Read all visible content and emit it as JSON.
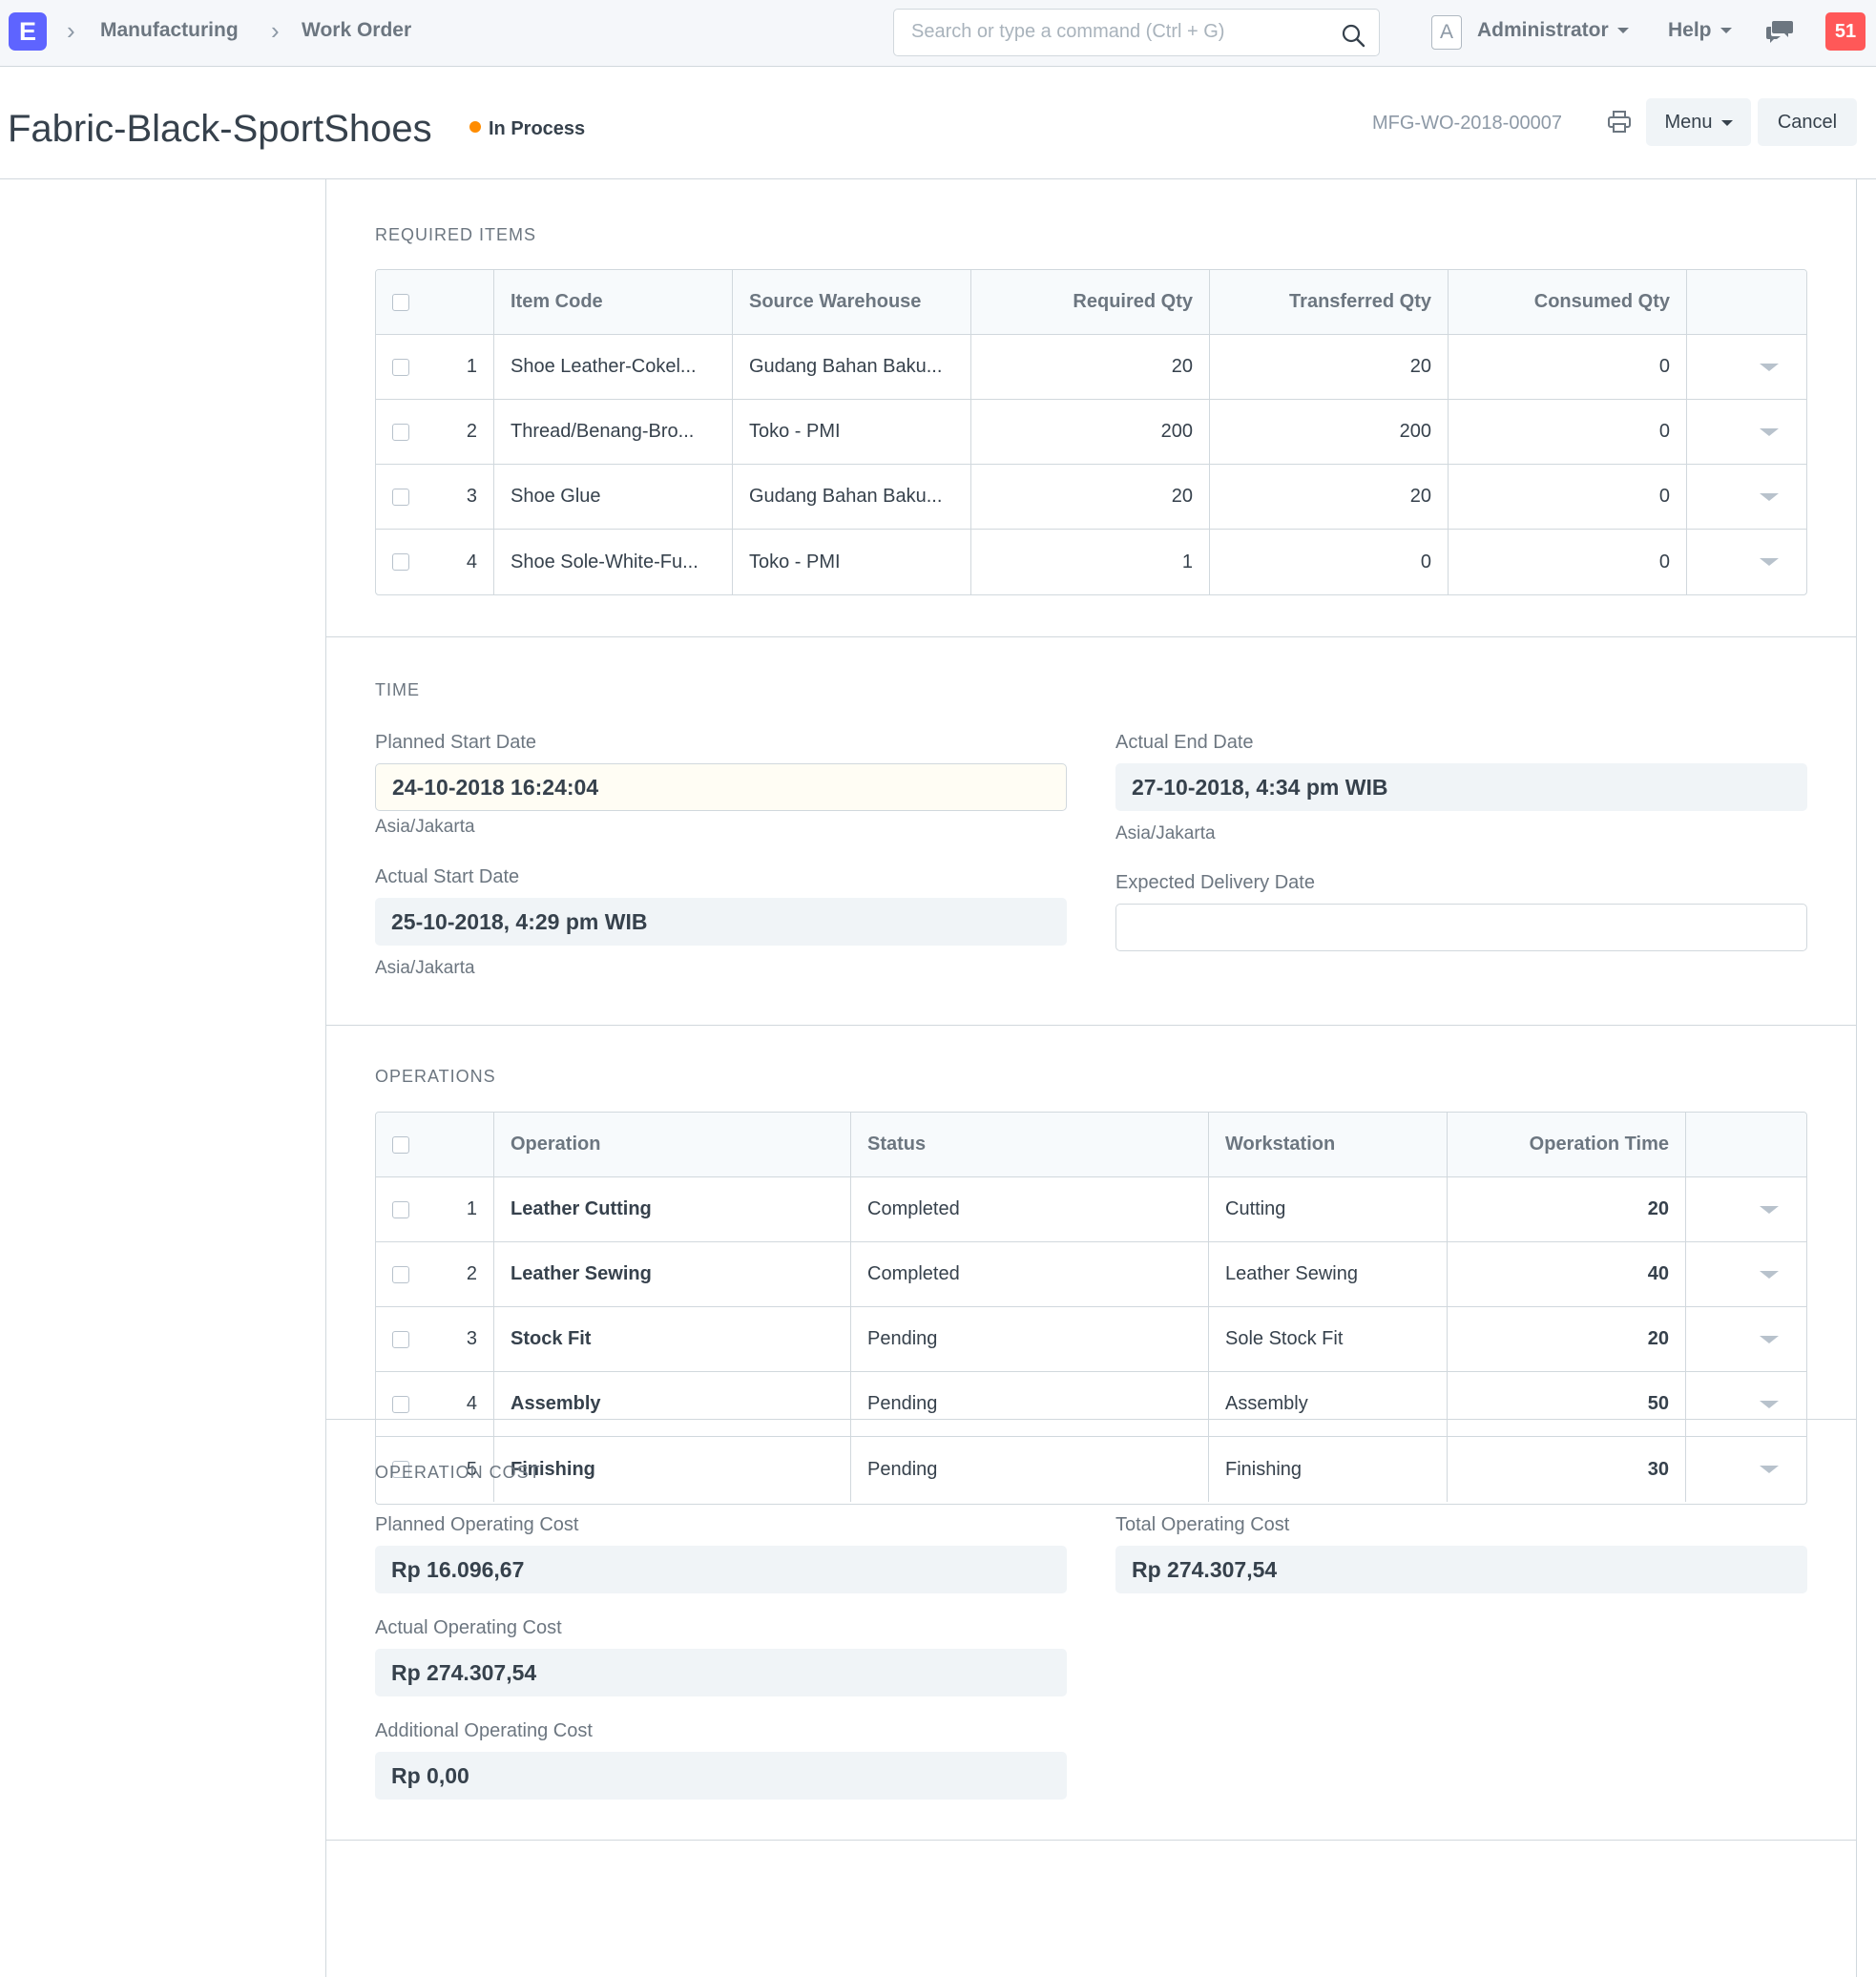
{
  "navbar": {
    "logo": "E",
    "breadcrumbs": [
      "Manufacturing",
      "Work Order"
    ],
    "search_placeholder": "Search or type a command (Ctrl + G)",
    "avatar_letter": "A",
    "user": "Administrator",
    "help": "Help",
    "notification_count": "51"
  },
  "page": {
    "title": "Fabric-Black-SportShoes",
    "status": "In Process",
    "status_color": "#ff8c00",
    "doc_name": "MFG-WO-2018-00007",
    "menu_label": "Menu",
    "cancel_label": "Cancel"
  },
  "required_items": {
    "heading": "REQUIRED ITEMS",
    "columns": [
      "Item Code",
      "Source Warehouse",
      "Required Qty",
      "Transferred Qty",
      "Consumed Qty"
    ],
    "rows": [
      {
        "idx": "1",
        "item_code": "Shoe Leather-Cokel...",
        "warehouse": "Gudang Bahan Baku...",
        "required": "20",
        "transferred": "20",
        "consumed": "0"
      },
      {
        "idx": "2",
        "item_code": "Thread/Benang-Bro...",
        "warehouse": "Toko - PMI",
        "required": "200",
        "transferred": "200",
        "consumed": "0"
      },
      {
        "idx": "3",
        "item_code": "Shoe Glue",
        "warehouse": "Gudang Bahan Baku...",
        "required": "20",
        "transferred": "20",
        "consumed": "0"
      },
      {
        "idx": "4",
        "item_code": "Shoe Sole-White-Fu...",
        "warehouse": "Toko - PMI",
        "required": "1",
        "transferred": "0",
        "consumed": "0"
      }
    ]
  },
  "time": {
    "heading": "TIME",
    "planned_start_label": "Planned Start Date",
    "planned_start_value": "24-10-2018 16:24:04",
    "planned_start_tz": "Asia/Jakarta",
    "actual_start_label": "Actual Start Date",
    "actual_start_value": "25-10-2018, 4:29 pm WIB",
    "actual_start_tz": "Asia/Jakarta",
    "actual_end_label": "Actual End Date",
    "actual_end_value": "27-10-2018, 4:34 pm WIB",
    "actual_end_tz": "Asia/Jakarta",
    "expected_delivery_label": "Expected Delivery Date",
    "expected_delivery_value": ""
  },
  "operations": {
    "heading": "OPERATIONS",
    "columns": [
      "Operation",
      "Status",
      "Workstation",
      "Operation Time"
    ],
    "rows": [
      {
        "idx": "1",
        "operation": "Leather Cutting",
        "status": "Completed",
        "workstation": "Cutting",
        "time": "20"
      },
      {
        "idx": "2",
        "operation": "Leather Sewing",
        "status": "Completed",
        "workstation": "Leather Sewing",
        "time": "40"
      },
      {
        "idx": "3",
        "operation": "Stock Fit",
        "status": "Pending",
        "workstation": "Sole Stock Fit",
        "time": "20"
      },
      {
        "idx": "4",
        "operation": "Assembly",
        "status": "Pending",
        "workstation": "Assembly",
        "time": "50"
      },
      {
        "idx": "5",
        "operation": "Finishing",
        "status": "Pending",
        "workstation": "Finishing",
        "time": "30"
      }
    ]
  },
  "operation_cost": {
    "heading": "OPERATION COST",
    "planned_label": "Planned Operating Cost",
    "planned_value": "Rp 16.096,67",
    "actual_label": "Actual Operating Cost",
    "actual_value": "Rp 274.307,54",
    "additional_label": "Additional Operating Cost",
    "additional_value": "Rp 0,00",
    "total_label": "Total Operating Cost",
    "total_value": "Rp 274.307,54"
  }
}
